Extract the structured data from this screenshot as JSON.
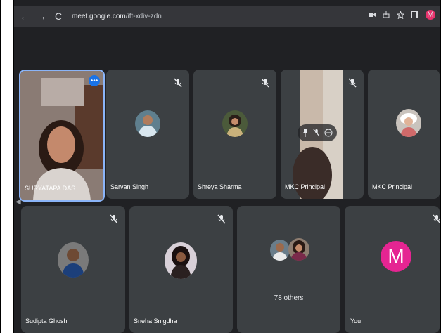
{
  "browser": {
    "back": "←",
    "forward": "→",
    "reload": "C",
    "url_domain": "meet.google.com",
    "url_path": "/ift-xdiv-zdn",
    "profile_initial": "M"
  },
  "participants": [
    {
      "name": "SURYATAPA DAS",
      "active": true
    },
    {
      "name": "Sarvan Singh"
    },
    {
      "name": "Shreya Sharma"
    },
    {
      "name": "MKC Principal"
    },
    {
      "name": "MKC Principal"
    },
    {
      "name": "Sudipta Ghosh"
    },
    {
      "name": "Sneha Snigdha"
    },
    {
      "name": "78 others"
    },
    {
      "name": "You",
      "initial": "M"
    }
  ],
  "colors": {
    "background": "#202124",
    "tile": "#3c4043",
    "active_border": "#8ab4f8",
    "you_avatar": "#e52592",
    "more_button": "#1a73e8"
  }
}
